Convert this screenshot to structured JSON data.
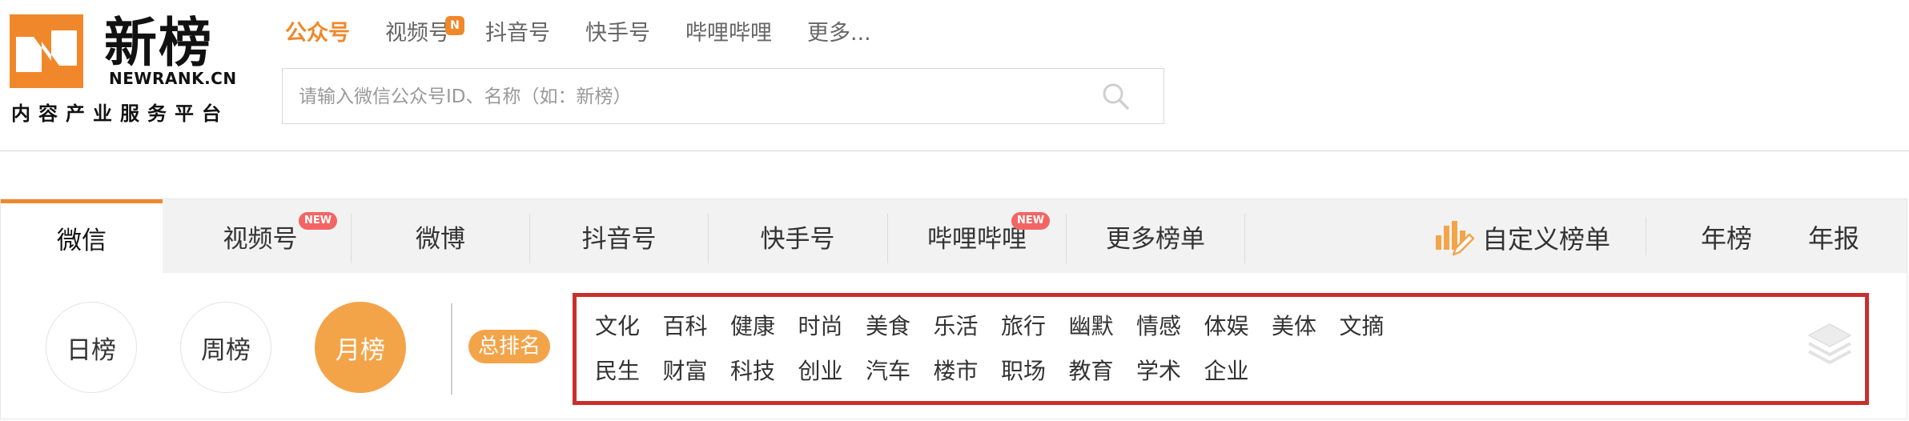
{
  "logo": {
    "mark": "newrank-logo",
    "name_zh": "新榜",
    "name_en": "NEWRANK.CN",
    "tagline": "内容产业服务平台",
    "brand_color": "#f0882b"
  },
  "topnav": {
    "items": [
      {
        "label": "公众号",
        "active": true
      },
      {
        "label": "视频号",
        "badge": "N"
      },
      {
        "label": "抖音号"
      },
      {
        "label": "快手号"
      },
      {
        "label": "哔哩哔哩"
      },
      {
        "label": "更多..."
      }
    ]
  },
  "search": {
    "value": "",
    "placeholder": "请输入微信公众号ID、名称（如：新榜）",
    "icon": "search-icon"
  },
  "tabs": [
    {
      "label": "微信",
      "active": true
    },
    {
      "label": "视频号",
      "badge": "NEW"
    },
    {
      "label": "微博"
    },
    {
      "label": "抖音号"
    },
    {
      "label": "快手号"
    },
    {
      "label": "哔哩哔哩",
      "badge": "NEW"
    },
    {
      "label": "更多榜单"
    }
  ],
  "tools": {
    "custom_rank": "自定义榜单",
    "custom_rank_icon": "chart-pencil-icon",
    "yearly_rank": "年榜",
    "yearly_report": "年报"
  },
  "periods": [
    {
      "label": "日榜"
    },
    {
      "label": "周榜"
    },
    {
      "label": "月榜",
      "active": true
    }
  ],
  "total_rank": "总排名",
  "categories": {
    "row1": [
      "文化",
      "百科",
      "健康",
      "时尚",
      "美食",
      "乐活",
      "旅行",
      "幽默",
      "情感",
      "体娱",
      "美体",
      "文摘"
    ],
    "row2": [
      "民生",
      "财富",
      "科技",
      "创业",
      "汽车",
      "楼市",
      "职场",
      "教育",
      "学术",
      "企业"
    ],
    "highlight_color": "#c8302d",
    "side_icon": "layers-icon"
  },
  "colors": {
    "accent": "#f0882b",
    "period_active": "#f3a449",
    "new_badge": "#f36565"
  }
}
